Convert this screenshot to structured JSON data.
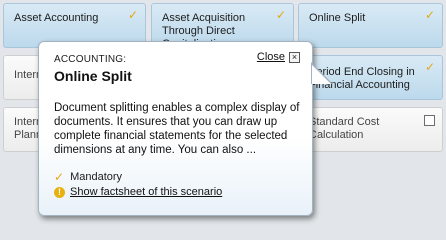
{
  "tiles": {
    "asset_accounting": "Asset Accounting",
    "asset_acquisition": "Asset Acquisition Through Direct Capitalization",
    "online_split": "Online Split",
    "internal_left": "Interna",
    "internal_planning_line1": "Interna",
    "internal_planning_line2": "Plannin",
    "period_end_closing": "Period End Closing in Financial Accounting",
    "standard_cost": "Standard Cost Calculation"
  },
  "popup": {
    "category": "ACCOUNTING:",
    "title": "Online Split",
    "close_label": "Close",
    "description": "Document splitting enables a complex display of documents. It ensures that you can draw up complete financial statements for the selected dimensions at any time. You can also ...",
    "mandatory_label": "Mandatory",
    "factsheet_link": "Show factsheet of this scenario"
  },
  "icons": {
    "check": "check-icon",
    "close": "close-icon",
    "info": "info-icon",
    "checkbox": "checkbox-icon"
  },
  "colors": {
    "selected_tile": "#bcd9ec",
    "check_mark": "#e8a512",
    "info_icon": "#e9b10c",
    "background": "#e2e6ea"
  }
}
